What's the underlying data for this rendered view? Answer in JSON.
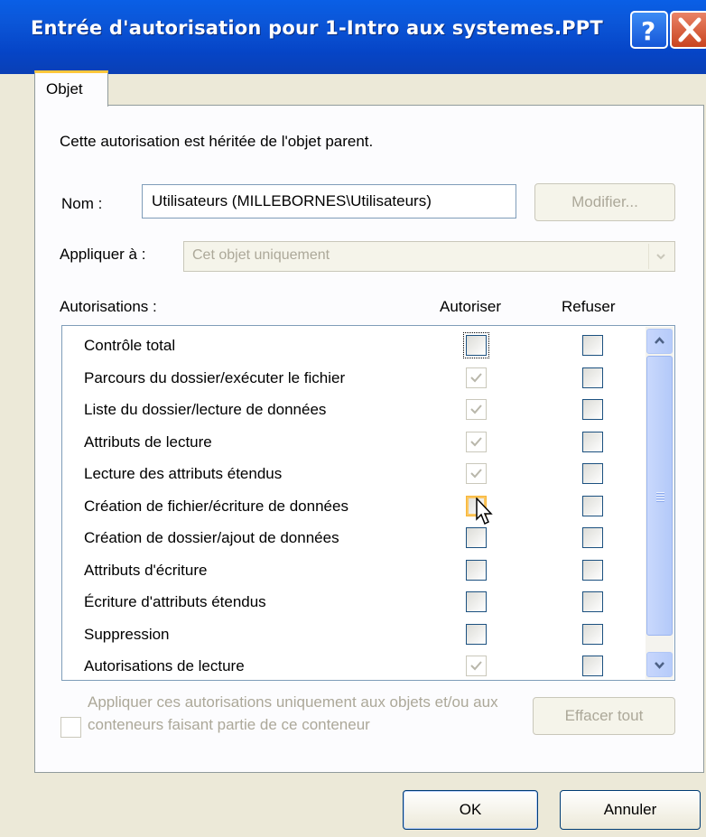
{
  "window": {
    "title": "Entrée d'autorisation pour 1-Intro aux systemes.PPT",
    "help_symbol": "?",
    "close_symbol": "X"
  },
  "tabs": [
    {
      "label": "Objet",
      "active": true
    }
  ],
  "info_text": "Cette autorisation est héritée de l'objet parent.",
  "name_label": "Nom :",
  "name_value": "Utilisateurs (MILLEBORNES\\Utilisateurs)",
  "modify_button": "Modifier...",
  "apply_to_label": "Appliquer à :",
  "apply_to_value": "Cet objet uniquement",
  "permissions_header": "Autorisations :",
  "allow_header": "Autoriser",
  "deny_header": "Refuser",
  "permissions": [
    {
      "label": "Contrôle total",
      "allow": "unchecked",
      "deny": "unchecked"
    },
    {
      "label": "Parcours du dossier/exécuter le fichier",
      "allow": "inherited-checked",
      "deny": "unchecked"
    },
    {
      "label": "Liste du dossier/lecture de données",
      "allow": "inherited-checked",
      "deny": "unchecked"
    },
    {
      "label": "Attributs de lecture",
      "allow": "inherited-checked",
      "deny": "unchecked"
    },
    {
      "label": "Lecture des attributs étendus",
      "allow": "inherited-checked",
      "deny": "unchecked"
    },
    {
      "label": "Création de fichier/écriture de données",
      "allow": "unchecked",
      "deny": "unchecked"
    },
    {
      "label": "Création de dossier/ajout de données",
      "allow": "unchecked",
      "deny": "unchecked"
    },
    {
      "label": "Attributs d'écriture",
      "allow": "unchecked",
      "deny": "unchecked"
    },
    {
      "label": "Écriture d'attributs étendus",
      "allow": "unchecked",
      "deny": "unchecked"
    },
    {
      "label": "Suppression",
      "allow": "unchecked",
      "deny": "unchecked"
    },
    {
      "label": "Autorisations de lecture",
      "allow": "inherited-checked",
      "deny": "unchecked"
    }
  ],
  "apply_only_text": "Appliquer ces autorisations uniquement aux objets et/ou aux conteneurs faisant partie de ce conteneur",
  "clear_all_button": "Effacer tout",
  "ok_button": "OK",
  "cancel_button": "Annuler",
  "colors": {
    "titlebar": "#0a5fe6",
    "disabled_text": "#aca899",
    "dialog_bg": "#ece9d8",
    "tab_accent": "#ffc73c"
  }
}
